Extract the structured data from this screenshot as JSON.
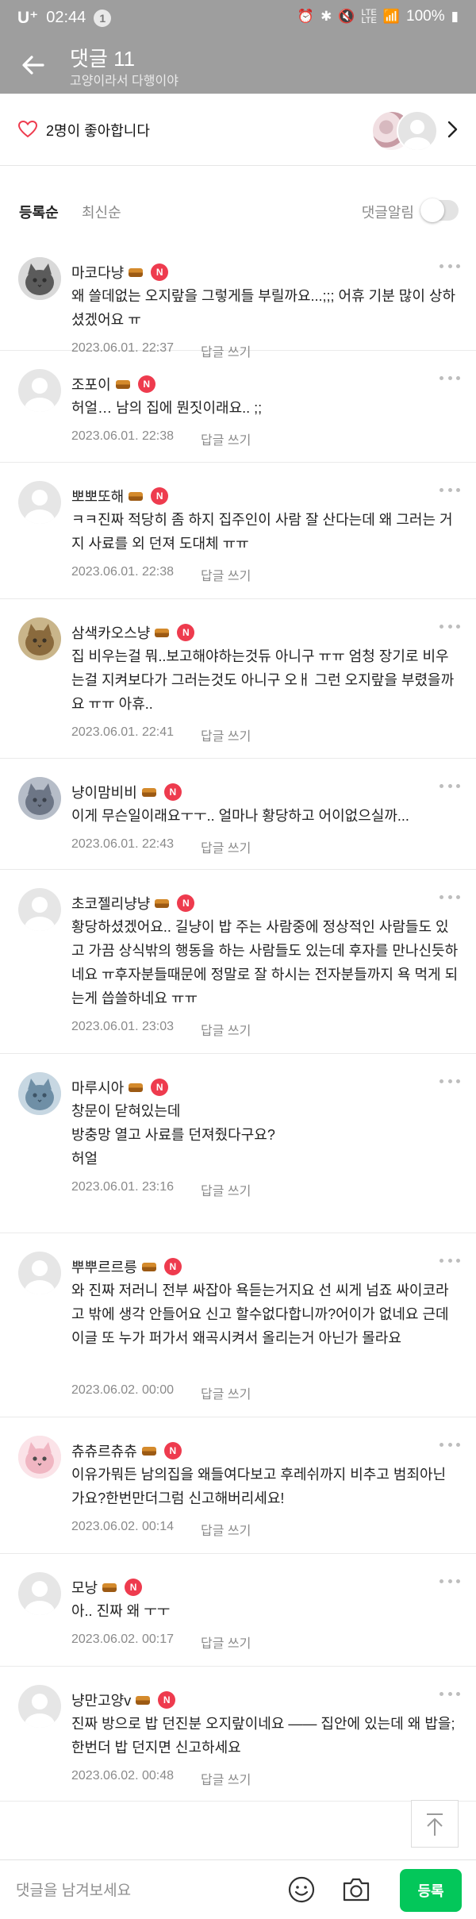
{
  "status_bar": {
    "carrier": "U⁺",
    "time": "02:44",
    "notification_count": "1",
    "battery": "100%",
    "icons": [
      "alarm-icon",
      "bluetooth-icon",
      "mute-icon",
      "lte-icon",
      "signal-icon",
      "battery-icon"
    ]
  },
  "header": {
    "title": "댓글 11",
    "subtitle": "고양이라서 다행이야"
  },
  "likes": {
    "text": "2명이 좋아합니다"
  },
  "sort": {
    "tabs": [
      "등록순",
      "최신순"
    ],
    "active_tab": "등록순",
    "alert_label": "댓글알림",
    "alert_on": false
  },
  "labels": {
    "reply": "답글 쓰기",
    "new_badge": "N"
  },
  "comments": [
    {
      "nick": "마코다냥",
      "text": "왜 쓸데없는 오지랖을 그렇게들 부릴까요...;;; 어휴 기분 많이 상하셨겠어요 ㅠ",
      "date": "2023.06.01. 22:37",
      "avatar": "cat-gray"
    },
    {
      "nick": "조포이",
      "text": "허얼… 남의 집에 뭔짓이래요.. ;;",
      "date": "2023.06.01. 22:38",
      "avatar": "default"
    },
    {
      "nick": "뽀뽀또해",
      "text": "ㅋㅋ진짜 적당히 좀 하지 집주인이 사람 잘 산다는데 왜 그러는 거지 사료를 외 던져 도대체 ㅠㅠ",
      "date": "2023.06.01. 22:38",
      "avatar": "default"
    },
    {
      "nick": "삼색카오스냥",
      "text": "집 비우는걸 뭐..보고해야하는것듀 아니구 ㅠㅠ 엄청 장기로 비우는걸 지켜보다가 그러는것도 아니구 오ㅐ 그런 오지랖을 부렸을까요 ㅠㅠ 아휴..",
      "date": "2023.06.01. 22:41",
      "avatar": "cat-calico"
    },
    {
      "nick": "냥이맘비비",
      "text": "이게 무슨일이래요ㅜㅜ.. 얼마나 황당하고 어이없으실까...",
      "date": "2023.06.01. 22:43",
      "avatar": "room"
    },
    {
      "nick": "초코젤리냥냥",
      "text": "황당하셨겠어요.. 길냥이 밥 주는 사람중에 정상적인 사람들도 있고 가끔 상식밖의 행동을 하는 사람들도 있는데 후자를 만나신듯하네요 ㅠ후자분들때문에 정말로 잘 하시는 전자분들까지 욕 먹게 되는게 씁쓸하네요 ㅠㅠ",
      "date": "2023.06.01. 23:03",
      "avatar": "default"
    },
    {
      "nick": "마루시아",
      "text": "창문이 닫혀있는데\n방충망 열고 사료를 던져줬다구요?\n허얼",
      "date": "2023.06.01. 23:16",
      "avatar": "cat-blue"
    },
    {
      "nick": "뿌뿌르르릉",
      "text": "와 진짜 저러니 전부 싸잡아 욕듣는거지요 선 씨게 넘죠 싸이코라고 밖에 생각 안들어요 신고 할수없다합니까?어이가 없네요 근데 이글 또 누가 퍼가서 왜곡시켜서 올리는거 아닌가 몰라요",
      "date": "2023.06.02. 00:00",
      "avatar": "default"
    },
    {
      "nick": "츄츄르츄츄",
      "text": "이유가뭐든 남의집을 왜들여다보고 후레쉬까지 비추고 범죄아닌가요?한번만더그럼 신고해버리세요!",
      "date": "2023.06.02. 00:14",
      "avatar": "cat-pink"
    },
    {
      "nick": "모낭",
      "text": "아.. 진짜 왜 ㅜㅜ",
      "date": "2023.06.02. 00:17",
      "avatar": "default"
    },
    {
      "nick": "냥만고양v",
      "text": "진짜 방으로 밥 던진분 오지랖이네요 —— 집안에 있는데 왜 밥을; 한번더 밥 던지면 신고하세요",
      "date": "2023.06.02. 00:48",
      "avatar": "default"
    }
  ],
  "input": {
    "placeholder": "댓글을 남겨보세요",
    "value": "",
    "submit_label": "등록"
  }
}
